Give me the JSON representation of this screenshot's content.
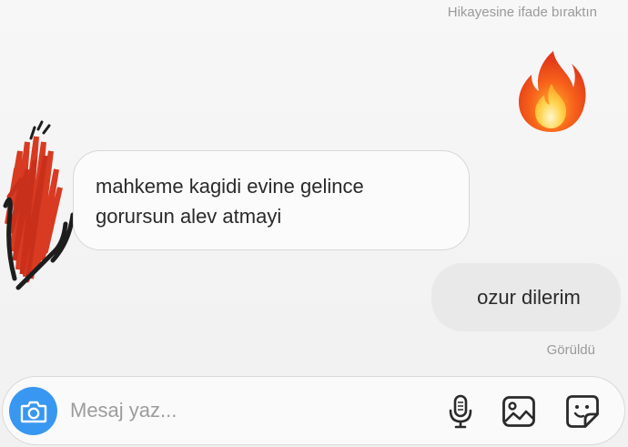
{
  "thread": {
    "reaction_note": "Hikayesine ifade bıraktın",
    "reaction_emoji": "fire-emoji",
    "messages": [
      {
        "direction": "incoming",
        "lines": [
          "mahkeme kagidi evine gelince",
          "gorursun alev atmayi"
        ]
      },
      {
        "direction": "outgoing",
        "text": "ozur dilerim"
      }
    ],
    "seen_status": "Görüldü"
  },
  "composer": {
    "placeholder": "Mesaj yaz...",
    "value": "",
    "icons": [
      "camera-icon",
      "microphone-icon",
      "gallery-icon",
      "sticker-icon"
    ]
  },
  "colors": {
    "accent": "#3897f0",
    "incoming_bubble": "#fbfbfb",
    "outgoing_bubble": "#e9e9e9",
    "muted_text": "#9a9a9a"
  }
}
